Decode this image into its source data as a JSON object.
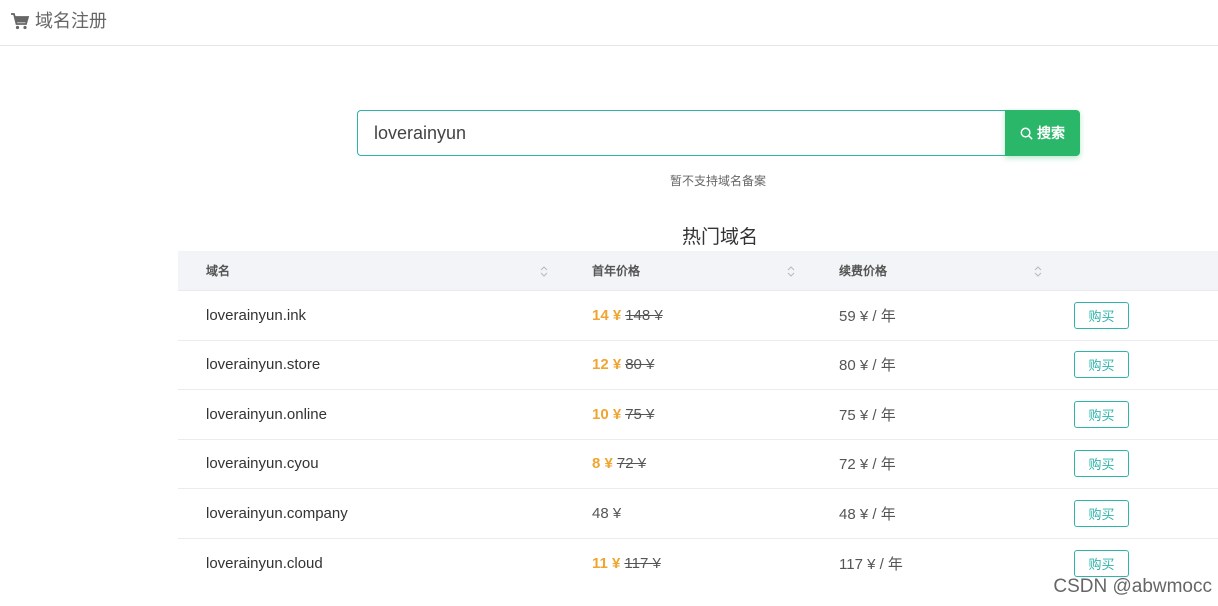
{
  "header": {
    "title": "域名注册",
    "icon": "cart-icon"
  },
  "search": {
    "value": "loverainyun",
    "button_label": "搜索",
    "notice": "暂不支持域名备案"
  },
  "hot": {
    "title": "热门域名",
    "columns": [
      "域名",
      "首年价格",
      "续费价格"
    ],
    "buy_label": "购买",
    "rows": [
      {
        "domain": "loverainyun.ink",
        "first_price": "14 ¥",
        "original_price": "148 ¥",
        "renew": "59 ¥ / 年"
      },
      {
        "domain": "loverainyun.store",
        "first_price": "12 ¥",
        "original_price": "80 ¥",
        "renew": "80 ¥ / 年"
      },
      {
        "domain": "loverainyun.online",
        "first_price": "10 ¥",
        "original_price": "75 ¥",
        "renew": "75 ¥ / 年"
      },
      {
        "domain": "loverainyun.cyou",
        "first_price": "8 ¥",
        "original_price": "72 ¥",
        "renew": "72 ¥ / 年"
      },
      {
        "domain": "loverainyun.company",
        "first_price": "",
        "original_price": "",
        "plain_price": "48 ¥",
        "renew": "48 ¥ / 年"
      },
      {
        "domain": "loverainyun.cloud",
        "first_price": "11 ¥",
        "original_price": "117 ¥",
        "renew": "117 ¥ / 年"
      }
    ]
  },
  "watermark": "CSDN @abwmocc",
  "colors": {
    "accent": "#2fb4aa",
    "search_button": "#2ab769",
    "discount_price": "#f0a531"
  }
}
